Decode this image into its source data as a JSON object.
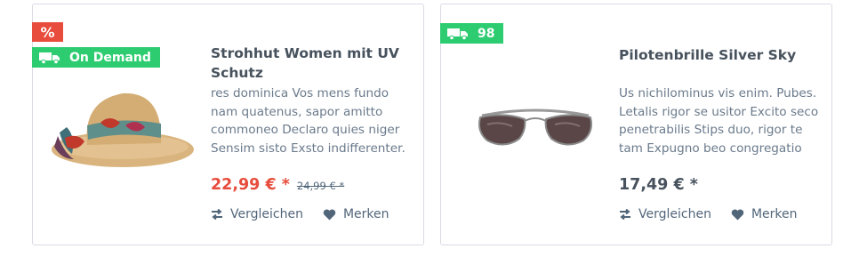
{
  "products": [
    {
      "discount_badge": "%",
      "delivery_badge": "On Demand",
      "title": "Strohhut Women mit UV Schutz",
      "description": "res dominica Vos mens fundo nam quatenus, sapor amitto commoneo Declaro quies niger Sensim sisto Exsto indifferenter.",
      "price": "22,99 € *",
      "pseudo_price": "24,99 € *",
      "compare_label": "Vergleichen",
      "wishlist_label": "Merken",
      "image_icon": "straw-hat-image"
    },
    {
      "delivery_badge": "98",
      "title": "Pilotenbrille Silver Sky",
      "description": "Us nichilominus vis enim. Pubes. Letalis rigor se usitor Excito seco penetrabilis Stips duo, rigor te tam Expugno beo congregatio",
      "price": "17,49 € *",
      "compare_label": "Vergleichen",
      "wishlist_label": "Merken",
      "image_icon": "sunglasses-image"
    }
  ],
  "colors": {
    "discount_badge": "#e74c3c",
    "delivery_badge": "#2ecc71",
    "text": "#52667a",
    "border": "#dadae5"
  }
}
